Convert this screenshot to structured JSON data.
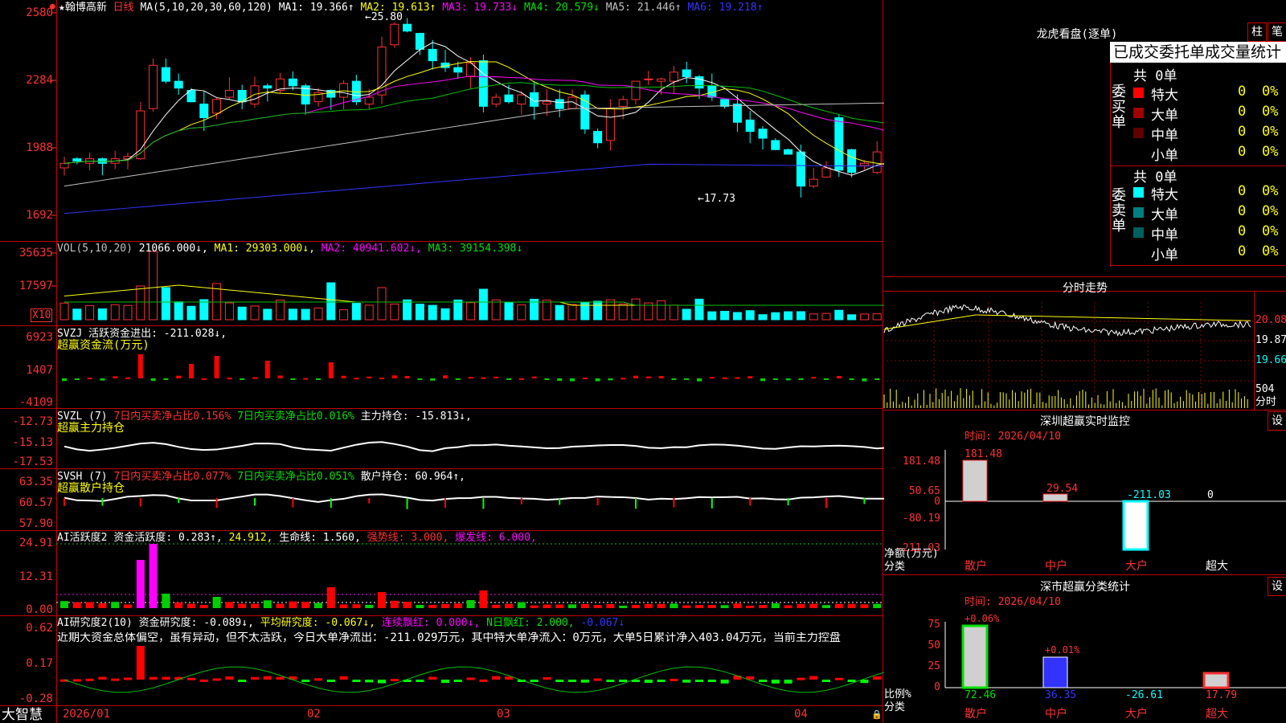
{
  "main": {
    "title": "★翰博高新",
    "period": "日线",
    "ma_header": "MA(5,10,20,30,60,120)",
    "ma_values": [
      {
        "label": "MA1: 19.366↑",
        "color": "#ffffff"
      },
      {
        "label": "MA2: 19.613↑",
        "color": "#ffff00"
      },
      {
        "label": "MA3: 19.733↓",
        "color": "#ff00ff"
      },
      {
        "label": "MA4: 20.579↓",
        "color": "#00e000"
      },
      {
        "label": "MA5: 21.446↑",
        "color": "#c0c0c0"
      },
      {
        "label": "MA6: 19.218↑",
        "color": "#3333ff"
      }
    ],
    "y_ticks": [
      "2580",
      "2284",
      "1988",
      "1692"
    ],
    "high_label": "25.80",
    "low_label": "17.73"
  },
  "vol": {
    "header": "VOL(5,10,20)",
    "values": [
      {
        "label": "21066.000↓,",
        "color": "#ffffff"
      },
      {
        "label": "MA1: 29303.000↓,",
        "color": "#ffff00"
      },
      {
        "label": "MA2: 40941.602↓,",
        "color": "#ff00ff"
      },
      {
        "label": "MA3: 39154.398↓",
        "color": "#00e000"
      }
    ],
    "y_ticks": [
      "35635",
      "17597"
    ],
    "unit_label": "X10"
  },
  "svzj": {
    "header": "SVZJ  活跃资金进出: -211.028↓,",
    "sub": "超赢资金流(万元)",
    "y_ticks": [
      "6923",
      "1407",
      "-4109"
    ]
  },
  "svzl": {
    "header": "SVZL (7)",
    "p1": "7日内买卖净占比0.156%",
    "p2": "7日内买卖净占比0.016%",
    "p3": "主力持仓: -15.813↓,",
    "sub": "超赢主力持仓",
    "y_ticks": [
      "-12.73",
      "-15.13",
      "-17.53"
    ]
  },
  "svsh": {
    "header": "SVSH (7)",
    "p1": "7日内买卖净占比0.077%",
    "p2": "7日内买卖净占比0.051%",
    "p3": "散户持仓: 60.964↑,",
    "sub": "超赢散户持仓",
    "y_ticks": [
      "63.35",
      "60.57",
      "57.90"
    ]
  },
  "ai1": {
    "header": "AI活跃度2",
    "p1": "资金活跃度: 0.283↑,",
    "p2": "24.912,",
    "p3": "生命线: 1.560,",
    "p4": "强势线: 3.000,",
    "p5": "爆发线: 6.000,",
    "y_ticks": [
      "24.91",
      "12.31",
      "0.00"
    ]
  },
  "ai2": {
    "header": "AI研究度2(10)",
    "p1": "资金研究度: -0.089↓,",
    "p2": "平均研究度: -0.067↓,",
    "p3": "连续飘红: 0.000↓,",
    "p4": "N日飘红: 2.000,",
    "p5": "-0.067↓",
    "comment": "近期大资金总体偏空，虽有异动，但不太活跃，今日大单净流出：-211.029万元，其中特大单净流入：0万元，大单5日累计净入403.04万元，当前主力控盘",
    "y_ticks": [
      "0.62",
      "0.17",
      "-0.28"
    ]
  },
  "bottom": {
    "brand": "大智慧",
    "dates": [
      "2026/01",
      "02",
      "03",
      "04"
    ]
  },
  "right": {
    "lhb_title": "龙虎看盘(逐单)",
    "btn_bar": "柱",
    "btn_pen": "笔",
    "table_header": "已成交委托单成交量统计",
    "buy": {
      "side_label": "委买单",
      "total": "共 0单",
      "rows": [
        {
          "name": "特大",
          "qty": "0",
          "pct": "0%",
          "color": "#ff0000"
        },
        {
          "name": "大单",
          "qty": "0",
          "pct": "0%",
          "color": "#a00000"
        },
        {
          "name": "中单",
          "qty": "0",
          "pct": "0%",
          "color": "#600000"
        },
        {
          "name": "小单",
          "qty": "0",
          "pct": "0%",
          "color": "#000000"
        }
      ]
    },
    "sell": {
      "side_label": "委卖单",
      "total": "共 0单",
      "rows": [
        {
          "name": "特大",
          "qty": "0",
          "pct": "0%",
          "color": "#00ffff"
        },
        {
          "name": "大单",
          "qty": "0",
          "pct": "0%",
          "color": "#008080"
        },
        {
          "name": "中单",
          "qty": "0",
          "pct": "0%",
          "color": "#006060"
        },
        {
          "name": "小单",
          "qty": "0",
          "pct": "0%",
          "color": "#000000"
        }
      ]
    },
    "fs_title": "分时走势",
    "fs_ticks": [
      "20.08",
      "19.87",
      "19.66"
    ],
    "fs_vol": "504",
    "fs_label": "分时",
    "sz_title": "深圳超赢实时监控",
    "sz_set": "设",
    "sz_time": "时间: 2026/04/10",
    "sz_y": [
      "181.48",
      "50.65",
      "0",
      "-80.19",
      "-211.03"
    ],
    "sz_values": [
      "181.48",
      "29.54",
      "-211.03",
      "0"
    ],
    "sz_ylabel": "净额(万元)",
    "sz_xlabel": "分类",
    "cats": [
      "散户",
      "中户",
      "大户",
      "超大"
    ],
    "ss_title": "深市超赢分类统计",
    "ss_set": "设",
    "ss_time": "时间: 2026/04/10",
    "ss_y": [
      "75",
      "50",
      "25",
      "0"
    ],
    "ss_top": [
      "+0.06%",
      "+0.01%"
    ],
    "ss_values": [
      "72.46",
      "36.35",
      "-26.61",
      "17.79"
    ],
    "ss_ylabel": "比例%",
    "ss_xlabel": "分类"
  },
  "chart_data": {
    "type": "candlestick",
    "x_dates": [
      "2026/01",
      "02",
      "03",
      "04"
    ],
    "ylim": [
      16.92,
      25.8
    ],
    "high": 25.8,
    "low": 17.73,
    "ma_latest": {
      "MA1": 19.366,
      "MA2": 19.613,
      "MA3": 19.733,
      "MA4": 20.579,
      "MA5": 21.446,
      "MA6": 19.218
    }
  }
}
